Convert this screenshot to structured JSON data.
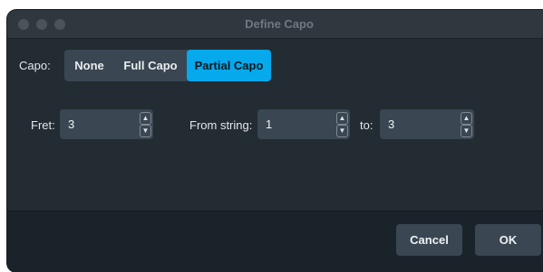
{
  "window": {
    "title": "Define Capo"
  },
  "capo": {
    "label": "Capo:",
    "options": [
      "None",
      "Full Capo",
      "Partial Capo"
    ],
    "selected": "Partial Capo"
  },
  "fret": {
    "label": "Fret:",
    "value": "3"
  },
  "from_string": {
    "label": "From string:",
    "value": "1"
  },
  "to_string": {
    "label": "to:",
    "value": "3"
  },
  "buttons": {
    "cancel": "Cancel",
    "ok": "OK"
  },
  "icons": {
    "increment": "chevron-up-icon",
    "decrement": "chevron-down-icon"
  },
  "colors": {
    "accent": "#05a9ec",
    "window_bg": "#232b33",
    "control_bg": "#3a4651"
  }
}
